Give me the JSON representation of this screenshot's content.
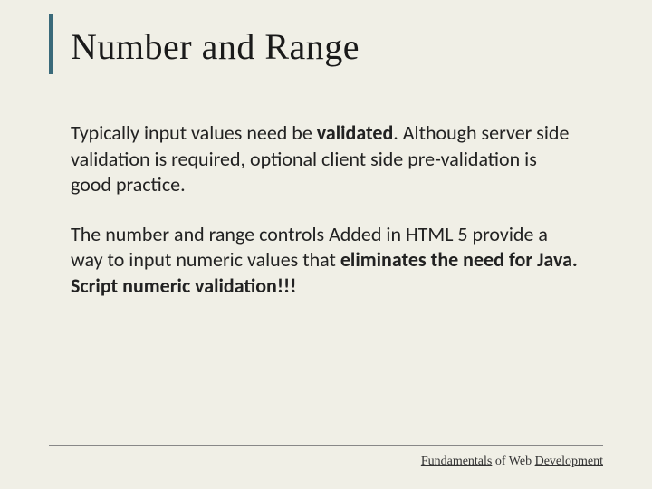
{
  "title": "Number and Range",
  "para1_prefix": "Typically input values need be ",
  "para1_bold": "validated",
  "para1_suffix": ". Although server side validation is required, optional client side pre-validation is good practice.",
  "para2_prefix": "The number and range controls Added in HTML 5 provide a way to input numeric values that ",
  "para2_bold": "eliminates the need for Java. Script numeric validation!!!",
  "footer_u1": "Fundamentals",
  "footer_mid": " of Web ",
  "footer_u2": "Development"
}
